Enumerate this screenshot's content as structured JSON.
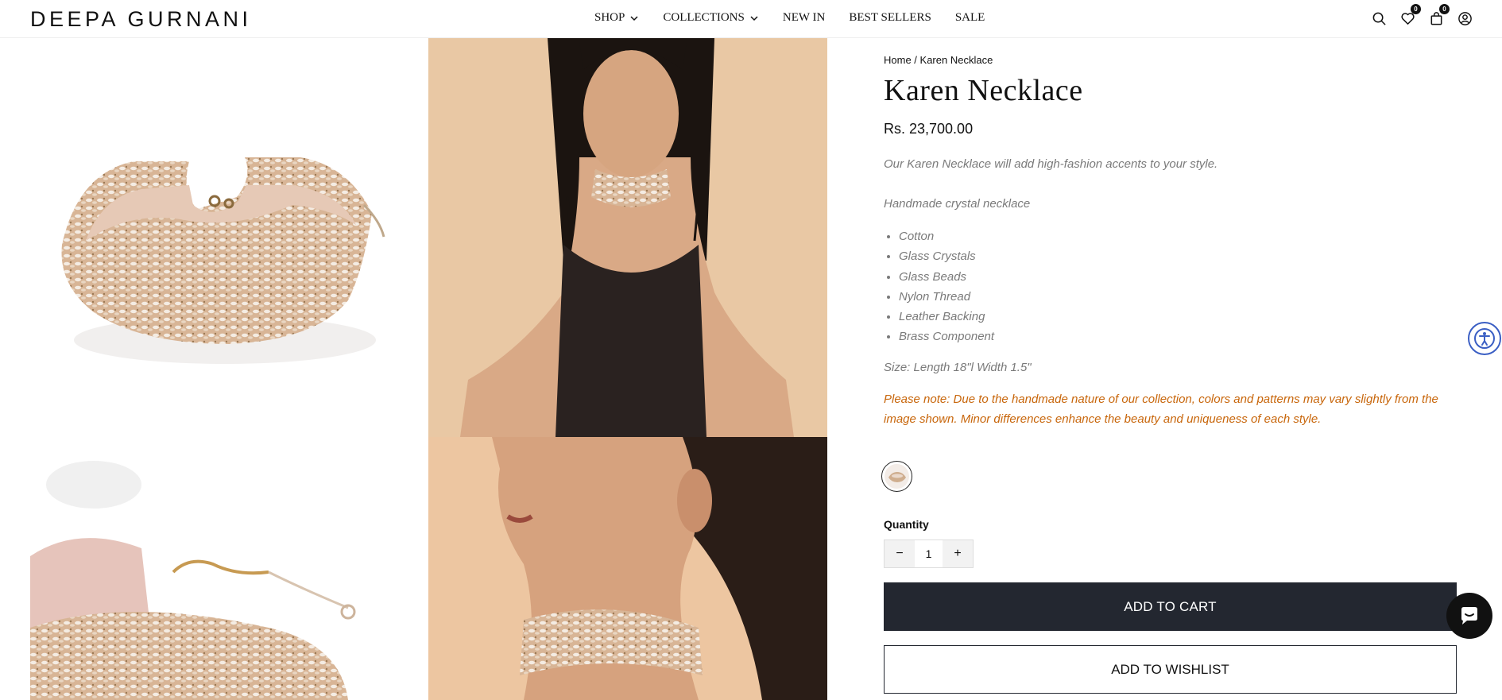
{
  "brand": {
    "logo": "DEEPA GURNANI"
  },
  "nav": {
    "items": [
      {
        "label": "SHOP",
        "dropdown": true
      },
      {
        "label": "COLLECTIONS",
        "dropdown": true
      },
      {
        "label": "NEW IN",
        "dropdown": false
      },
      {
        "label": "BEST SELLERS",
        "dropdown": false
      },
      {
        "label": "SALE",
        "dropdown": false
      }
    ]
  },
  "header": {
    "icons": [
      "search-icon",
      "heart-icon",
      "bag-icon",
      "account-icon"
    ],
    "wishlist_count": "0",
    "cart_count": "0"
  },
  "breadcrumb": {
    "home": "Home",
    "separator": " / ",
    "current": "Karen Necklace"
  },
  "product": {
    "title": "Karen Necklace",
    "price": "Rs. 23,700.00",
    "description": "Our Karen Necklace will add high-fashion accents to your style.",
    "subtitle": "Handmade crystal necklace",
    "materials": [
      "Cotton",
      "Glass Crystals",
      "Glass Beads",
      "Nylon Thread",
      "Leather Backing",
      "Brass Component"
    ],
    "size": "Size: Length 18\"l Width 1.5\"",
    "note": "Please note: Due to the handmade nature of our collection, colors and patterns may vary slightly from the image shown. Minor differences enhance the beauty and uniqueness of each style."
  },
  "quantity": {
    "label": "Quantity",
    "value": "1",
    "minus": "−",
    "plus": "+"
  },
  "actions": {
    "add_to_cart": "ADD TO CART",
    "add_to_wishlist": "ADD TO WISHLIST"
  },
  "colors": {
    "accent_dark": "#232730",
    "note_orange": "#c8660b",
    "access_blue": "#3b5fc4"
  }
}
